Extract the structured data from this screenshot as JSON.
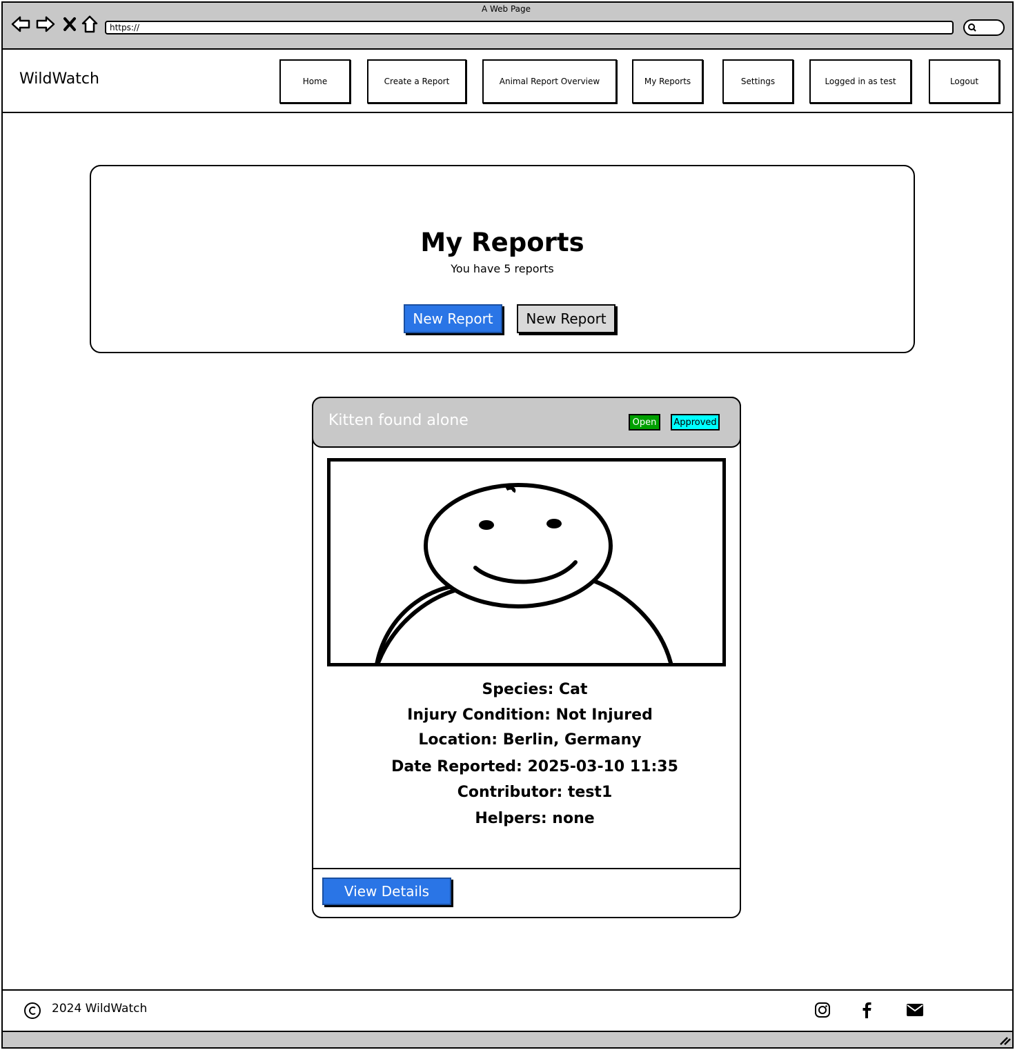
{
  "browser": {
    "window_title": "A Web Page",
    "url": "https://"
  },
  "nav": {
    "brand": "WildWatch",
    "items": [
      {
        "label": "Home"
      },
      {
        "label": "Create a Report"
      },
      {
        "label": "Animal Report Overview"
      },
      {
        "label": "My Reports"
      },
      {
        "label": "Settings"
      },
      {
        "label": "Logged in as test"
      },
      {
        "label": "Logout"
      }
    ]
  },
  "hero": {
    "title": "My Reports",
    "subtitle": "You have 5 reports",
    "primary_button": "New Report",
    "secondary_button": "New Report"
  },
  "report": {
    "title": "Kitten found alone",
    "badges": [
      {
        "label": "Open",
        "color": "#00a000"
      },
      {
        "label": "Approved",
        "color": "#00ffff"
      }
    ],
    "image_icon": "person-placeholder-icon",
    "fields": [
      {
        "text": "Species: Cat"
      },
      {
        "text": "Injury Condition: Not Injured"
      },
      {
        "text": "Location: Berlin, Germany"
      },
      {
        "text": "Date Reported: 2025-03-10 11:35"
      },
      {
        "text": "Contributor: test1"
      },
      {
        "text": "Helpers: none"
      }
    ],
    "details_button": "View Details"
  },
  "footer": {
    "text": "2024 WildWatch",
    "social_icons": [
      "instagram-icon",
      "facebook-icon",
      "email-icon"
    ]
  },
  "colors": {
    "primary": "#2a75e6",
    "chrome": "#c8c8c8"
  }
}
